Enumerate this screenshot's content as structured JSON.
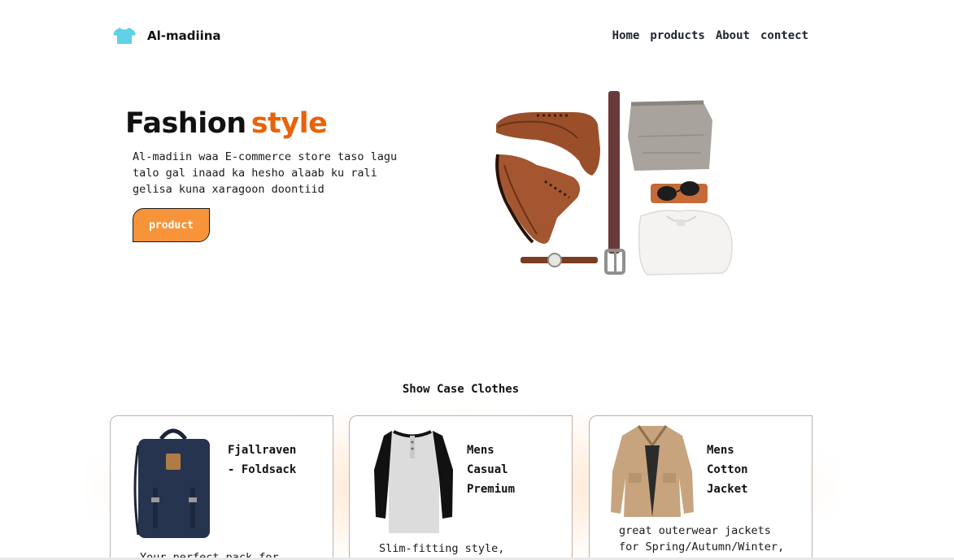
{
  "brand": {
    "name": "Al-madiina",
    "icon": "tshirt-icon",
    "icon_color": "#5ed1e8"
  },
  "nav": {
    "links": [
      "Home",
      "products",
      "About",
      "contect"
    ]
  },
  "hero": {
    "title_main": "Fashion",
    "title_accent": "style",
    "accent_color": "#e8630a",
    "description_lines": [
      "Al-madiin waa E-commerce store taso lagu",
      "talo gal inaad ka hesho alaab ku rali",
      "gelisa kuna xaragoon doontiid"
    ],
    "button_label": "product",
    "button_color": "#f7943a",
    "image": "fashion-flatlay-image"
  },
  "showcase": {
    "title": "Show Case Clothes",
    "cards": [
      {
        "name_lines": [
          "Fjallraven",
          "- Foldsack"
        ],
        "desc_lines": [
          "Your perfect pack for"
        ],
        "image": "backpack-image"
      },
      {
        "name_lines": [
          "Mens",
          "Casual",
          "Premium"
        ],
        "desc_lines": [
          "Slim-fitting style,"
        ],
        "image": "raglan-shirt-image"
      },
      {
        "name_lines": [
          "Mens",
          "Cotton",
          "Jacket"
        ],
        "desc_lines": [
          "great outerwear jackets",
          "for Spring/Autumn/Winter,"
        ],
        "image": "cotton-jacket-image"
      }
    ]
  }
}
